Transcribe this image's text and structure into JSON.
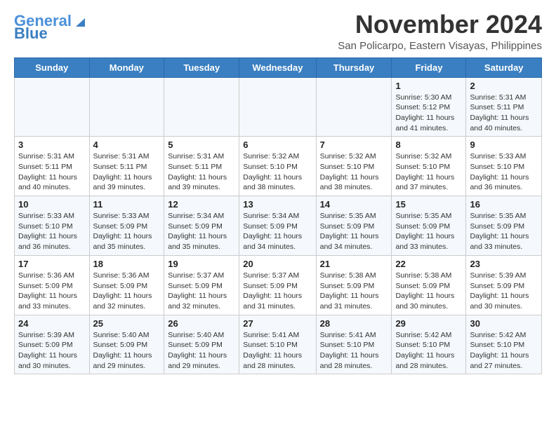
{
  "header": {
    "logo_main": "General",
    "logo_accent": "Blue",
    "title": "November 2024",
    "subtitle": "San Policarpo, Eastern Visayas, Philippines"
  },
  "weekdays": [
    "Sunday",
    "Monday",
    "Tuesday",
    "Wednesday",
    "Thursday",
    "Friday",
    "Saturday"
  ],
  "weeks": [
    [
      {
        "day": "",
        "sunrise": "",
        "sunset": "",
        "daylight": ""
      },
      {
        "day": "",
        "sunrise": "",
        "sunset": "",
        "daylight": ""
      },
      {
        "day": "",
        "sunrise": "",
        "sunset": "",
        "daylight": ""
      },
      {
        "day": "",
        "sunrise": "",
        "sunset": "",
        "daylight": ""
      },
      {
        "day": "",
        "sunrise": "",
        "sunset": "",
        "daylight": ""
      },
      {
        "day": "1",
        "sunrise": "Sunrise: 5:30 AM",
        "sunset": "Sunset: 5:12 PM",
        "daylight": "Daylight: 11 hours and 41 minutes."
      },
      {
        "day": "2",
        "sunrise": "Sunrise: 5:31 AM",
        "sunset": "Sunset: 5:11 PM",
        "daylight": "Daylight: 11 hours and 40 minutes."
      }
    ],
    [
      {
        "day": "3",
        "sunrise": "Sunrise: 5:31 AM",
        "sunset": "Sunset: 5:11 PM",
        "daylight": "Daylight: 11 hours and 40 minutes."
      },
      {
        "day": "4",
        "sunrise": "Sunrise: 5:31 AM",
        "sunset": "Sunset: 5:11 PM",
        "daylight": "Daylight: 11 hours and 39 minutes."
      },
      {
        "day": "5",
        "sunrise": "Sunrise: 5:31 AM",
        "sunset": "Sunset: 5:11 PM",
        "daylight": "Daylight: 11 hours and 39 minutes."
      },
      {
        "day": "6",
        "sunrise": "Sunrise: 5:32 AM",
        "sunset": "Sunset: 5:10 PM",
        "daylight": "Daylight: 11 hours and 38 minutes."
      },
      {
        "day": "7",
        "sunrise": "Sunrise: 5:32 AM",
        "sunset": "Sunset: 5:10 PM",
        "daylight": "Daylight: 11 hours and 38 minutes."
      },
      {
        "day": "8",
        "sunrise": "Sunrise: 5:32 AM",
        "sunset": "Sunset: 5:10 PM",
        "daylight": "Daylight: 11 hours and 37 minutes."
      },
      {
        "day": "9",
        "sunrise": "Sunrise: 5:33 AM",
        "sunset": "Sunset: 5:10 PM",
        "daylight": "Daylight: 11 hours and 36 minutes."
      }
    ],
    [
      {
        "day": "10",
        "sunrise": "Sunrise: 5:33 AM",
        "sunset": "Sunset: 5:10 PM",
        "daylight": "Daylight: 11 hours and 36 minutes."
      },
      {
        "day": "11",
        "sunrise": "Sunrise: 5:33 AM",
        "sunset": "Sunset: 5:09 PM",
        "daylight": "Daylight: 11 hours and 35 minutes."
      },
      {
        "day": "12",
        "sunrise": "Sunrise: 5:34 AM",
        "sunset": "Sunset: 5:09 PM",
        "daylight": "Daylight: 11 hours and 35 minutes."
      },
      {
        "day": "13",
        "sunrise": "Sunrise: 5:34 AM",
        "sunset": "Sunset: 5:09 PM",
        "daylight": "Daylight: 11 hours and 34 minutes."
      },
      {
        "day": "14",
        "sunrise": "Sunrise: 5:35 AM",
        "sunset": "Sunset: 5:09 PM",
        "daylight": "Daylight: 11 hours and 34 minutes."
      },
      {
        "day": "15",
        "sunrise": "Sunrise: 5:35 AM",
        "sunset": "Sunset: 5:09 PM",
        "daylight": "Daylight: 11 hours and 33 minutes."
      },
      {
        "day": "16",
        "sunrise": "Sunrise: 5:35 AM",
        "sunset": "Sunset: 5:09 PM",
        "daylight": "Daylight: 11 hours and 33 minutes."
      }
    ],
    [
      {
        "day": "17",
        "sunrise": "Sunrise: 5:36 AM",
        "sunset": "Sunset: 5:09 PM",
        "daylight": "Daylight: 11 hours and 33 minutes."
      },
      {
        "day": "18",
        "sunrise": "Sunrise: 5:36 AM",
        "sunset": "Sunset: 5:09 PM",
        "daylight": "Daylight: 11 hours and 32 minutes."
      },
      {
        "day": "19",
        "sunrise": "Sunrise: 5:37 AM",
        "sunset": "Sunset: 5:09 PM",
        "daylight": "Daylight: 11 hours and 32 minutes."
      },
      {
        "day": "20",
        "sunrise": "Sunrise: 5:37 AM",
        "sunset": "Sunset: 5:09 PM",
        "daylight": "Daylight: 11 hours and 31 minutes."
      },
      {
        "day": "21",
        "sunrise": "Sunrise: 5:38 AM",
        "sunset": "Sunset: 5:09 PM",
        "daylight": "Daylight: 11 hours and 31 minutes."
      },
      {
        "day": "22",
        "sunrise": "Sunrise: 5:38 AM",
        "sunset": "Sunset: 5:09 PM",
        "daylight": "Daylight: 11 hours and 30 minutes."
      },
      {
        "day": "23",
        "sunrise": "Sunrise: 5:39 AM",
        "sunset": "Sunset: 5:09 PM",
        "daylight": "Daylight: 11 hours and 30 minutes."
      }
    ],
    [
      {
        "day": "24",
        "sunrise": "Sunrise: 5:39 AM",
        "sunset": "Sunset: 5:09 PM",
        "daylight": "Daylight: 11 hours and 30 minutes."
      },
      {
        "day": "25",
        "sunrise": "Sunrise: 5:40 AM",
        "sunset": "Sunset: 5:09 PM",
        "daylight": "Daylight: 11 hours and 29 minutes."
      },
      {
        "day": "26",
        "sunrise": "Sunrise: 5:40 AM",
        "sunset": "Sunset: 5:09 PM",
        "daylight": "Daylight: 11 hours and 29 minutes."
      },
      {
        "day": "27",
        "sunrise": "Sunrise: 5:41 AM",
        "sunset": "Sunset: 5:10 PM",
        "daylight": "Daylight: 11 hours and 28 minutes."
      },
      {
        "day": "28",
        "sunrise": "Sunrise: 5:41 AM",
        "sunset": "Sunset: 5:10 PM",
        "daylight": "Daylight: 11 hours and 28 minutes."
      },
      {
        "day": "29",
        "sunrise": "Sunrise: 5:42 AM",
        "sunset": "Sunset: 5:10 PM",
        "daylight": "Daylight: 11 hours and 28 minutes."
      },
      {
        "day": "30",
        "sunrise": "Sunrise: 5:42 AM",
        "sunset": "Sunset: 5:10 PM",
        "daylight": "Daylight: 11 hours and 27 minutes."
      }
    ]
  ]
}
